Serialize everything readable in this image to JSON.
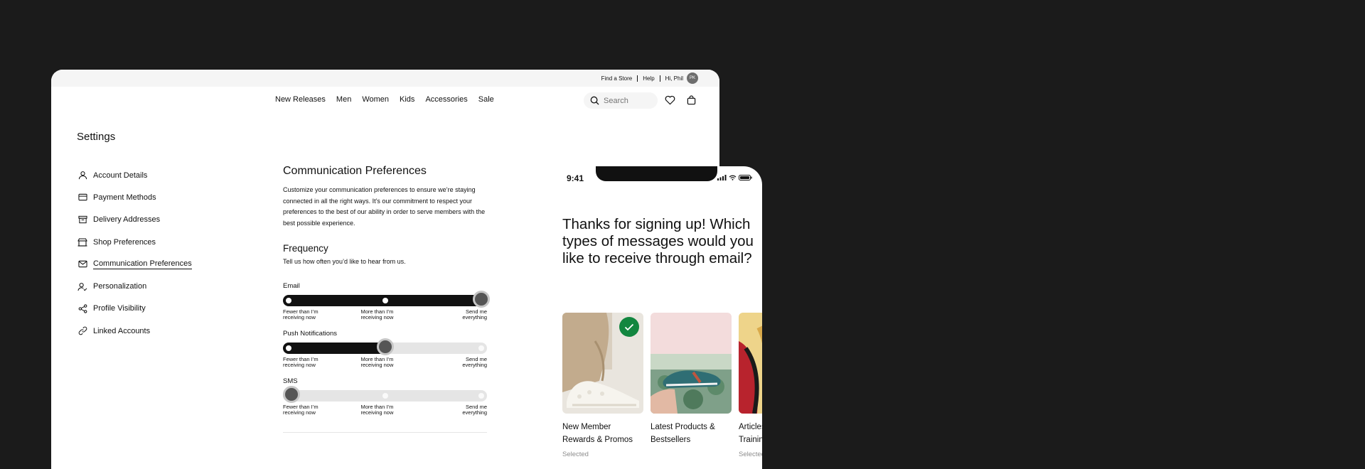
{
  "utility_bar": {
    "find_store": "Find a Store",
    "help": "Help",
    "greeting": "Hi, Phil",
    "avatar_initials": "PK"
  },
  "nav": {
    "links": [
      "New Releases",
      "Men",
      "Women",
      "Kids",
      "Accessories",
      "Sale"
    ],
    "search_placeholder": "Search"
  },
  "settings": {
    "title": "Settings",
    "sidebar": [
      {
        "label": "Account Details",
        "icon": "user-icon",
        "active": false
      },
      {
        "label": "Payment Methods",
        "icon": "credit-card-icon",
        "active": false
      },
      {
        "label": "Delivery Addresses",
        "icon": "box-icon",
        "active": false
      },
      {
        "label": "Shop Preferences",
        "icon": "store-icon",
        "active": false
      },
      {
        "label": "Communication Preferences",
        "icon": "mail-icon",
        "active": true
      },
      {
        "label": "Personalization",
        "icon": "user-check-icon",
        "active": false
      },
      {
        "label": "Profile Visibility",
        "icon": "share-icon",
        "active": false
      },
      {
        "label": "Linked Accounts",
        "icon": "link-icon",
        "active": false
      }
    ]
  },
  "content": {
    "heading": "Communication Preferences",
    "description": "Customize your communication preferences to ensure we’re staying connected in all the right ways. It’s our commitment to respect your preferences to the best of our ability in order to serve members with the best possible experience.",
    "frequency_title": "Frequency",
    "frequency_subtitle": "Tell us how often you’d like to hear from us.",
    "tick_labels": {
      "low_1": "Fewer than I’m",
      "low_2": "receiving now",
      "mid_1": "More than I’m",
      "mid_2": "receiving now",
      "high_1": "Send me",
      "high_2": "everything"
    },
    "sliders": [
      {
        "label": "Email",
        "level": 2,
        "max": 2
      },
      {
        "label": "Push Notifications",
        "level": 1,
        "max": 2
      },
      {
        "label": "SMS",
        "level": 0,
        "max": 2
      }
    ]
  },
  "phone": {
    "time": "9:41",
    "heading": "Thanks for signing up! Which types of messages would you like to receive through email?",
    "cards": [
      {
        "title_1": "New Member",
        "title_2": "Rewards & Promos",
        "status": "Selected",
        "selected": true
      },
      {
        "title_1": "Latest Products &",
        "title_2": "Bestsellers",
        "status": "",
        "selected": false
      },
      {
        "title_1": "Articles &",
        "title_2": "Training",
        "status": "Selected",
        "selected": false
      }
    ]
  },
  "colors": {
    "background": "#1b1b1b",
    "accent_green": "#12863f",
    "track_fill": "#111111",
    "track_empty": "#e5e5e5"
  }
}
